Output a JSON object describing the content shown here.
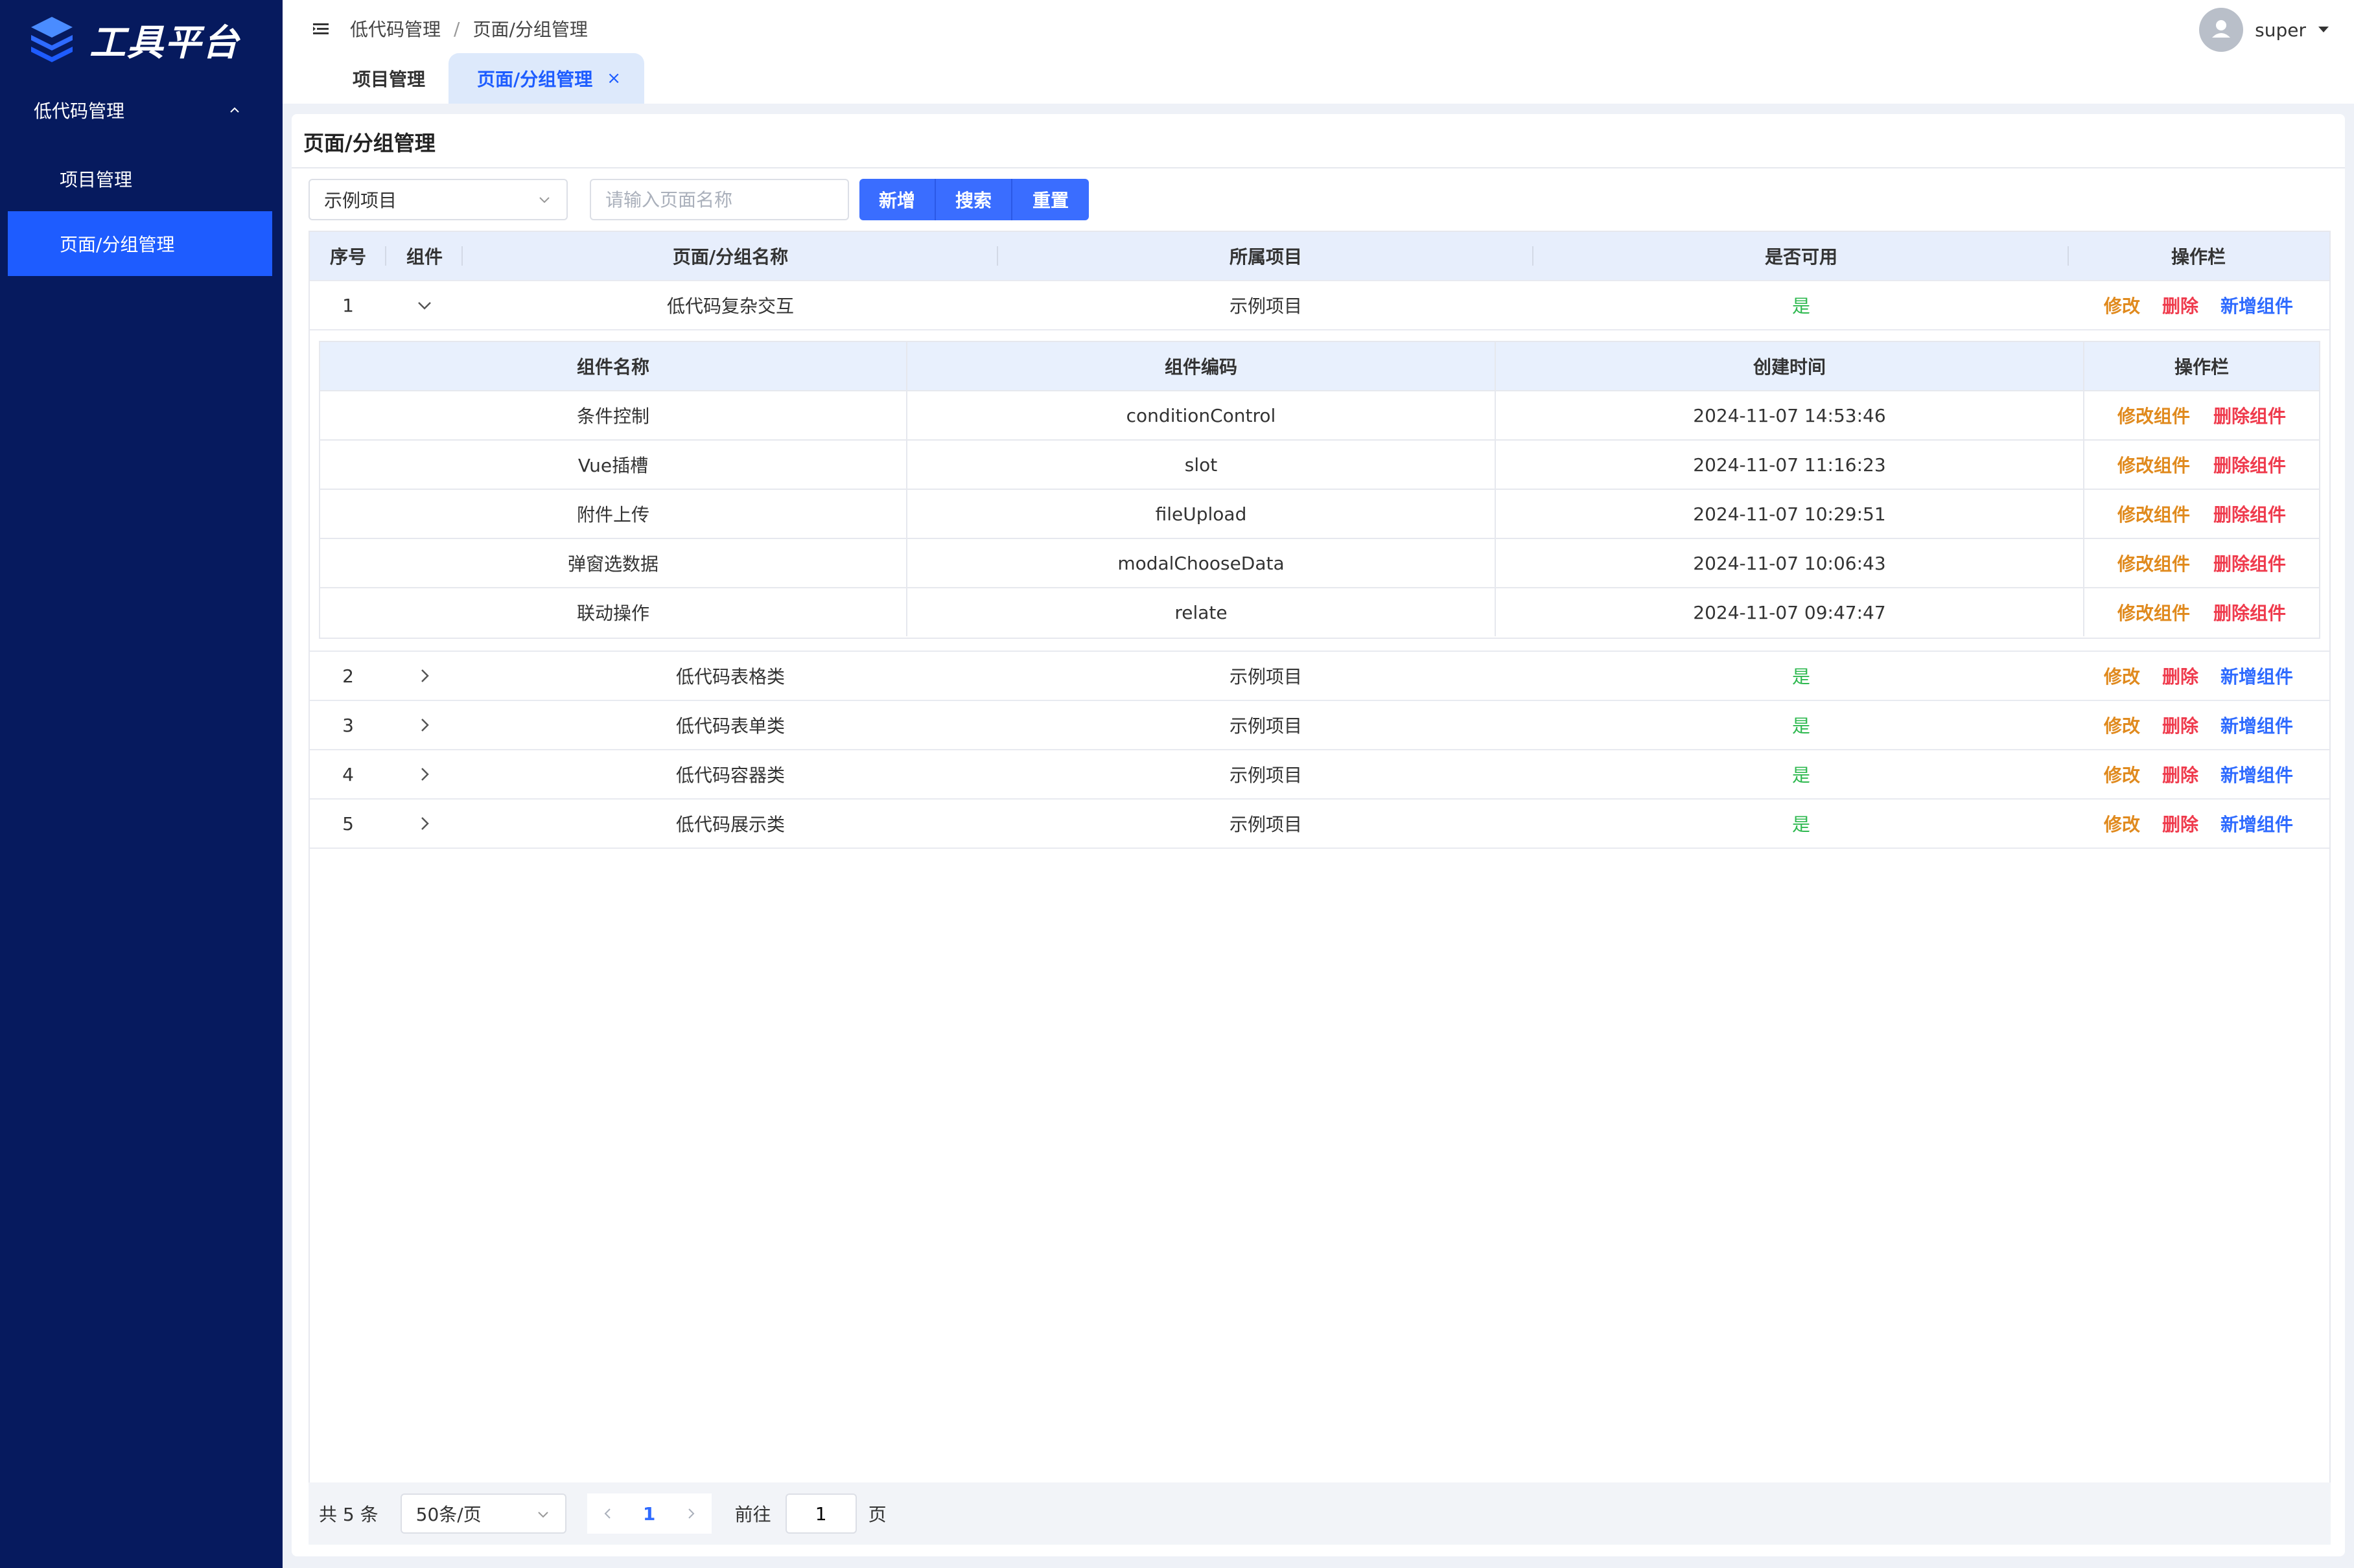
{
  "app": {
    "title": "工具平台"
  },
  "sidebar": {
    "group_label": "低代码管理",
    "items": [
      {
        "label": "项目管理"
      },
      {
        "label": "页面/分组管理"
      }
    ]
  },
  "header": {
    "breadcrumb": [
      "低代码管理",
      "页面/分组管理"
    ],
    "breadcrumb_separator": "/",
    "user_name": "super",
    "tabs": [
      {
        "label": "项目管理"
      },
      {
        "label": "页面/分组管理",
        "close": "×"
      }
    ]
  },
  "main": {
    "title": "页面/分组管理",
    "project_select": "示例项目",
    "search_placeholder": "请输入页面名称",
    "buttons": {
      "add": "新增",
      "search": "搜索",
      "reset": "重置"
    },
    "table": {
      "headers": [
        "序号",
        "组件",
        "页面/分组名称",
        "所属项目",
        "是否可用",
        "操作栏"
      ],
      "rows": [
        {
          "index": "1",
          "name": "低代码复杂交互",
          "project": "示例项目",
          "available": "是"
        },
        {
          "index": "2",
          "name": "低代码表格类",
          "project": "示例项目",
          "available": "是"
        },
        {
          "index": "3",
          "name": "低代码表单类",
          "project": "示例项目",
          "available": "是"
        },
        {
          "index": "4",
          "name": "低代码容器类",
          "project": "示例项目",
          "available": "是"
        },
        {
          "index": "5",
          "name": "低代码展示类",
          "project": "示例项目",
          "available": "是"
        }
      ],
      "actions": {
        "edit": "修改",
        "delete": "删除",
        "add_component": "新增组件"
      }
    },
    "nested_table": {
      "headers": [
        "组件名称",
        "组件编码",
        "创建时间",
        "操作栏"
      ],
      "rows": [
        {
          "name": "条件控制",
          "code": "conditionControl",
          "created": "2024-11-07 14:53:46"
        },
        {
          "name": "Vue插槽",
          "code": "slot",
          "created": "2024-11-07 11:16:23"
        },
        {
          "name": "附件上传",
          "code": "fileUpload",
          "created": "2024-11-07 10:29:51"
        },
        {
          "name": "弹窗选数据",
          "code": "modalChooseData",
          "created": "2024-11-07 10:06:43"
        },
        {
          "name": "联动操作",
          "code": "relate",
          "created": "2024-11-07 09:47:47"
        }
      ],
      "actions": {
        "edit": "修改组件",
        "delete": "删除组件"
      }
    },
    "pagination": {
      "total": "共 5 条",
      "page_size": "50条/页",
      "current_page": "1",
      "goto_label": "前往",
      "goto_value": "1",
      "page_unit": "页"
    }
  },
  "colors": {
    "sidebar_bg": "#061a5e",
    "active_blue": "#1e5cff",
    "edit_orange": "#e08a1e",
    "delete_red": "#ef3b4d",
    "add_blue": "#2f6bff",
    "available_green": "#2fb950"
  },
  "icons": [
    "logo-layers-icon",
    "chevron-up-icon",
    "hamburger-icon",
    "user-icon",
    "caret-down-icon",
    "chevron-down-icon",
    "chevron-right-icon",
    "close-icon",
    "prev-page-icon",
    "next-page-icon"
  ]
}
